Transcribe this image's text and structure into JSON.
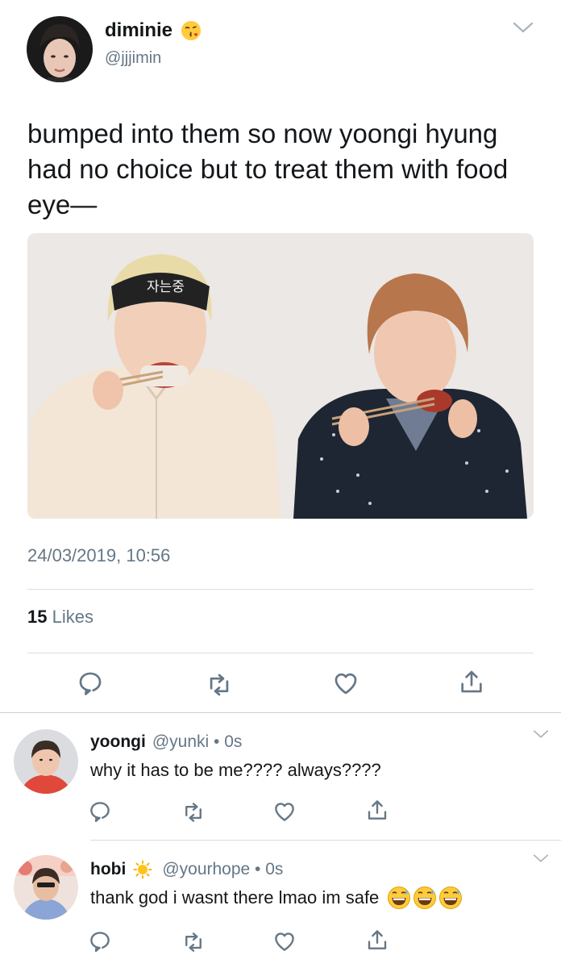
{
  "main_tweet": {
    "display_name": "diminie",
    "name_emoji": "face-blowing-kiss-emoji",
    "handle": "@jjjimin",
    "text": "bumped into them so now yoongi hyung had no choice but to treat them with food eye—",
    "mask_text": "자는중",
    "timestamp": "24/03/2019, 10:56",
    "likes_count": "15",
    "likes_label": "Likes",
    "actions": [
      "reply-icon",
      "retweet-icon",
      "like-icon",
      "share-icon"
    ]
  },
  "replies": [
    {
      "display_name": "yoongi",
      "handle": "@yunki • 0s",
      "text": "why it has to be me???? always????",
      "emojis": []
    },
    {
      "display_name": "hobi",
      "name_emoji": "sun-emoji",
      "handle": "@yourhope • 0s",
      "text": "thank god i wasnt there lmao im safe",
      "emojis": [
        "grinning-sweat-emoji",
        "grinning-sweat-emoji",
        "grinning-sweat-emoji"
      ]
    }
  ],
  "colors": {
    "text": "#14171a",
    "secondary": "#657786",
    "divider": "#d8dee3",
    "icon": "#657786"
  }
}
